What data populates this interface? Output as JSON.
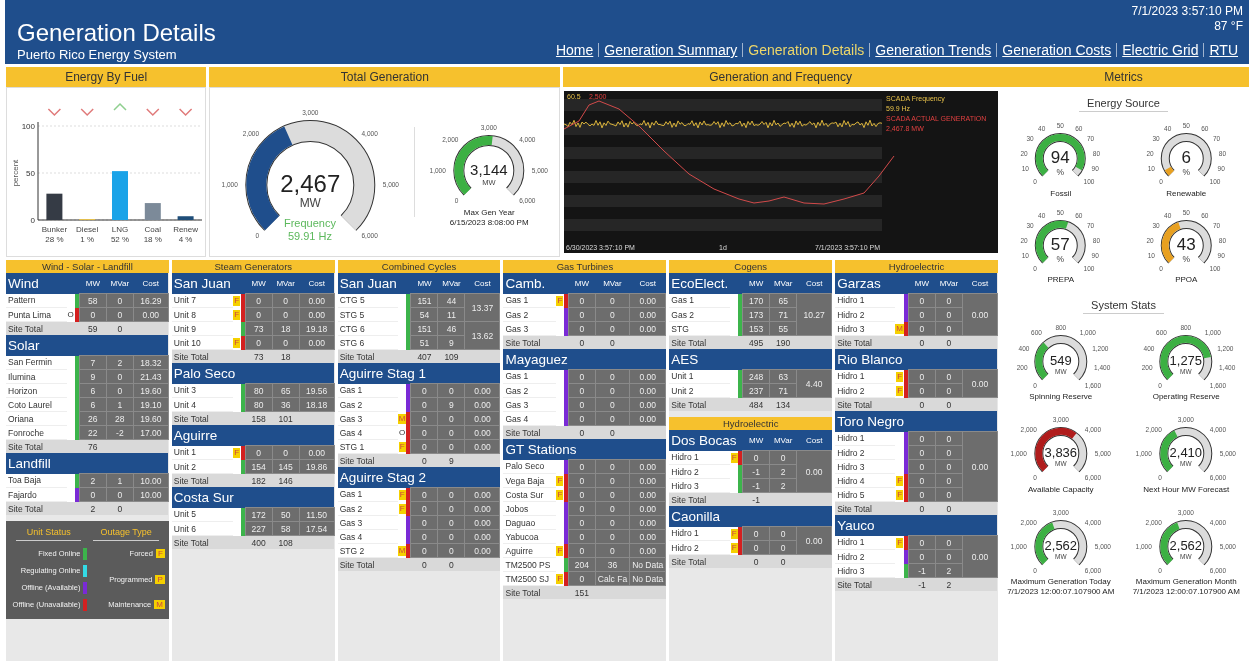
{
  "header": {
    "title": "Generation Details",
    "subtitle": "Puerto Rico Energy System",
    "datetime": "7/1/2023 3:57:10 PM",
    "temperature": "87 °F",
    "nav": [
      {
        "label": "Home",
        "selected": false
      },
      {
        "label": "Generation Summary",
        "selected": false
      },
      {
        "label": "Generation Details",
        "selected": true
      },
      {
        "label": "Generation Trends",
        "selected": false
      },
      {
        "label": "Generation Costs",
        "selected": false
      },
      {
        "label": "Electric Grid",
        "selected": false
      },
      {
        "label": "RTU",
        "selected": false
      }
    ]
  },
  "energy_by_fuel": {
    "title": "Energy By Fuel",
    "bars": [
      {
        "rising": false,
        "color": "#353b45",
        "value_label": "28 %"
      },
      {
        "rising": false,
        "color": "#e8c24a",
        "value_label": "1 %"
      },
      {
        "rising": true,
        "color": "#1aa3e8",
        "value_label": "52 %"
      },
      {
        "rising": false,
        "color": "#7c8a99",
        "value_label": "18 %"
      },
      {
        "rising": false,
        "color": "#1f4e79",
        "value_label": "4 %"
      }
    ],
    "chart_data": {
      "type": "bar",
      "ylabel": "percent",
      "categories": [
        "Bunker",
        "Diesel",
        "LNG",
        "Coal",
        "Renew"
      ],
      "values": [
        28,
        1,
        52,
        18,
        4
      ],
      "ylim": [
        0,
        100
      ],
      "yticks": [
        0,
        50,
        100
      ]
    }
  },
  "total_generation": {
    "title": "Total Generation",
    "main_gauge": {
      "value": "2,467",
      "unit": "MW",
      "color": "#1f4e8c",
      "ticks": [
        "0",
        "1,000",
        "2,000",
        "3,000",
        "4,000",
        "5,000",
        "6,000"
      ],
      "caption": "Frequency",
      "reading": "59.91 Hz"
    },
    "max_gauge": {
      "value": "3,144",
      "unit": "MW",
      "color": "#3cb043",
      "ticks": [
        "0",
        "1,000",
        "2,000",
        "3,000",
        "4,000",
        "5,000",
        "6,000"
      ],
      "caption": "Max Gen Year",
      "reading": "6/15/2023 8:08:00 PM"
    }
  },
  "generation_frequency": {
    "title": "Generation and Frequency",
    "axis_top": [
      {
        "text": "60.5",
        "kind": "frequency"
      },
      {
        "text": "2,500",
        "kind": "generation"
      }
    ],
    "legend": [
      {
        "text": "SCADA Frequency",
        "kind": "frequency"
      },
      {
        "text": "59.9 Hz",
        "kind": "frequency"
      },
      {
        "text": "SCADA ACTUAL GENERATION",
        "kind": "generation"
      },
      {
        "text": "2,467.8 MW",
        "kind": "generation"
      }
    ],
    "x_labels": [
      "6/30/2023 3:57:10 PM",
      "1d",
      "7/1/2023 3:57:10 PM"
    ]
  },
  "metrics": {
    "title": "Metrics",
    "sections": [
      {
        "title": "Energy Source",
        "gauges": [
          {
            "value": "94",
            "unit": "%",
            "label": "Fossil",
            "color": "#3cb043",
            "ticks": [
              "0",
              "10",
              "20",
              "30",
              "40",
              "50",
              "60",
              "70",
              "80",
              "90",
              "100"
            ]
          },
          {
            "value": "6",
            "unit": "%",
            "label": "Renewable",
            "color": "#e8a020",
            "ticks": [
              "0",
              "10",
              "20",
              "30",
              "40",
              "50",
              "60",
              "70",
              "80",
              "90",
              "100"
            ]
          },
          {
            "value": "57",
            "unit": "%",
            "label": "PREPA",
            "color": "#3cb043",
            "ticks": [
              "0",
              "10",
              "20",
              "30",
              "40",
              "50",
              "60",
              "70",
              "80",
              "90",
              "100"
            ]
          },
          {
            "value": "43",
            "unit": "%",
            "label": "PPOA",
            "color": "#e8a020",
            "ticks": [
              "0",
              "10",
              "20",
              "30",
              "40",
              "50",
              "60",
              "70",
              "80",
              "90",
              "100"
            ]
          }
        ]
      },
      {
        "title": "System Stats",
        "gauges": [
          {
            "value": "549",
            "unit": "MW",
            "label": "Spinning Reserve",
            "color": "#3cb043",
            "ticks": [
              "0",
              "200",
              "400",
              "600",
              "800",
              "1,000",
              "1,200",
              "1,400",
              "1,600"
            ]
          },
          {
            "value": "1,275",
            "unit": "MW",
            "label": "Operating Reserve",
            "color": "#3cb043",
            "ticks": [
              "0",
              "200",
              "400",
              "600",
              "800",
              "1,000",
              "1,200",
              "1,400",
              "1,600"
            ]
          },
          {
            "value": "3,836",
            "unit": "MW",
            "label": "Available Capacity",
            "color": "#b01c1c",
            "ticks": [
              "0",
              "1,000",
              "2,000",
              "3,000",
              "4,000",
              "5,000",
              "6,000"
            ]
          },
          {
            "value": "2,410",
            "unit": "MW",
            "label": "Next Hour MW Forecast",
            "color": "#3cb043",
            "ticks": [
              "0",
              "1,000",
              "2,000",
              "3,000",
              "4,000",
              "5,000",
              "6,000"
            ]
          },
          {
            "value": "2,562",
            "unit": "MW",
            "label": "Maximum Generation Today",
            "sublabel": "7/1/2023 12:00:07.107900 AM",
            "color": "#3cb043",
            "ticks": [
              "0",
              "1,000",
              "2,000",
              "3,000",
              "4,000",
              "5,000",
              "6,000"
            ]
          },
          {
            "value": "2,562",
            "unit": "MW",
            "label": "Maximum Generation Month",
            "sublabel": "7/1/2023 12:00:07.107900 AM",
            "color": "#3cb043",
            "ticks": [
              "0",
              "1,000",
              "2,000",
              "3,000",
              "4,000",
              "5,000",
              "6,000"
            ]
          }
        ]
      }
    ]
  },
  "unit_columns": [
    [
      {
        "kind": "units",
        "title": "Wind - Solar - Landfill",
        "sites": [
          {
            "name": "Wind",
            "columns": [
              "MW",
              "MVar",
              "Cost"
            ],
            "units": [
              {
                "name": "Pattern",
                "color": "#3cb44b",
                "mw": "58",
                "mvar": "0",
                "cost": "16.29"
              },
              {
                "name": "Punta Lima",
                "color": "#d42020",
                "flag": "O",
                "flag_boxed": false,
                "mw": "0",
                "mvar": "0",
                "cost": "0.00"
              }
            ],
            "total": {
              "label": "Site Total",
              "mw": "59",
              "mvar": "0"
            }
          },
          {
            "name": "Solar",
            "units": [
              {
                "name": "San Fermin",
                "color": "#3cb44b",
                "mw": "7",
                "mvar": "2",
                "cost": "18.32"
              },
              {
                "name": "Ilumina",
                "color": "#3cb44b",
                "mw": "9",
                "mvar": "0",
                "cost": "21.43"
              },
              {
                "name": "Horizon",
                "color": "#3cb44b",
                "mw": "6",
                "mvar": "0",
                "cost": "19.60"
              },
              {
                "name": "Coto Laurel",
                "color": "#3cb44b",
                "mw": "6",
                "mvar": "1",
                "cost": "19.10"
              },
              {
                "name": "Oriana",
                "color": "#3cb44b",
                "mw": "26",
                "mvar": "28",
                "cost": "19.60"
              },
              {
                "name": "Fonroche",
                "color": "#3cb44b",
                "mw": "22",
                "mvar": "-2",
                "cost": "17.00"
              }
            ],
            "total": {
              "label": "Site Total",
              "mw": "76"
            }
          },
          {
            "name": "Landfill",
            "units": [
              {
                "name": "Toa Baja",
                "color": "#3cb44b",
                "mw": "2",
                "mvar": "1",
                "cost": "10.00"
              },
              {
                "name": "Fajardo",
                "color": "#7a2ad6",
                "mw": "0",
                "mvar": "0",
                "cost": "10.00"
              }
            ],
            "total": {
              "label": "Site Total",
              "mw": "2",
              "mvar": "0"
            }
          }
        ]
      },
      {
        "kind": "legend",
        "status_title": "Unit Status",
        "outage_title": "Outage Type",
        "statuses": [
          {
            "label": "Fixed Online",
            "color": "#3cb44b"
          },
          {
            "label": "Regulating Online",
            "color": "#33dbe6"
          },
          {
            "label": "Offline (Available)",
            "color": "#7a2ad6"
          },
          {
            "label": "Offline (Unavailable)",
            "color": "#d42020"
          }
        ],
        "outages": [
          {
            "label": "Forced",
            "flag": "F"
          },
          {
            "label": "Programmed",
            "flag": "P"
          },
          {
            "label": "Maintenance",
            "flag": "M"
          }
        ]
      }
    ],
    [
      {
        "kind": "units",
        "title": "Steam Generators",
        "sites": [
          {
            "name": "San Juan",
            "columns": [
              "MW",
              "MVar",
              "Cost"
            ],
            "units": [
              {
                "name": "Unit 7",
                "color": "#d42020",
                "flag": "F",
                "flag_boxed": true,
                "mw": "0",
                "mvar": "0",
                "cost": "0.00"
              },
              {
                "name": "Unit 8",
                "color": "#d42020",
                "flag": "F",
                "flag_boxed": true,
                "mw": "0",
                "mvar": "0",
                "cost": "0.00"
              },
              {
                "name": "Unit 9",
                "color": "#3cb44b",
                "mw": "73",
                "mvar": "18",
                "cost": "19.18"
              },
              {
                "name": "Unit 10",
                "color": "#d42020",
                "flag": "F",
                "flag_boxed": true,
                "mw": "0",
                "mvar": "0",
                "cost": "0.00"
              }
            ],
            "total": {
              "label": "Site Total",
              "mw": "73",
              "mvar": "18"
            }
          },
          {
            "name": "Palo Seco",
            "units": [
              {
                "name": "Unit 3",
                "color": "#3cb44b",
                "mw": "80",
                "mvar": "65",
                "cost": "19.56"
              },
              {
                "name": "Unit 4",
                "color": "#3cb44b",
                "mw": "80",
                "mvar": "36",
                "cost": "18.18"
              }
            ],
            "total": {
              "label": "Site Total",
              "mw": "158",
              "mvar": "101"
            }
          },
          {
            "name": "Aguirre",
            "units": [
              {
                "name": "Unit 1",
                "color": "#d42020",
                "flag": "F",
                "flag_boxed": true,
                "mw": "0",
                "mvar": "0",
                "cost": "0.00"
              },
              {
                "name": "Unit 2",
                "color": "#3cb44b",
                "mw": "154",
                "mvar": "145",
                "cost": "19.86"
              }
            ],
            "total": {
              "label": "Site Total",
              "mw": "182",
              "mvar": "146"
            }
          },
          {
            "name": "Costa Sur",
            "units": [
              {
                "name": "Unit 5",
                "color": "#3cb44b",
                "mw": "172",
                "mvar": "50",
                "cost": "11.50"
              },
              {
                "name": "Unit 6",
                "color": "#3cb44b",
                "mw": "227",
                "mvar": "58",
                "cost": "17.54"
              }
            ],
            "total": {
              "label": "Site Total",
              "mw": "400",
              "mvar": "108"
            }
          }
        ]
      }
    ],
    [
      {
        "kind": "units",
        "title": "Combined Cycles",
        "sites": [
          {
            "name": "San Juan",
            "columns": [
              "MW",
              "MVar",
              "Cost"
            ],
            "units": [
              {
                "name": "CTG 5",
                "color": "#3cb44b",
                "mw": "151",
                "mvar": "44",
                "cost": "13.37"
              },
              {
                "name": "STG 5",
                "color": "#3cb44b",
                "mw": "54",
                "mvar": "11"
              },
              {
                "name": "CTG 6",
                "color": "#3cb44b",
                "mw": "151",
                "mvar": "46",
                "cost": "13.62"
              },
              {
                "name": "STG 6",
                "color": "#3cb44b",
                "mw": "51",
                "mvar": "9"
              }
            ],
            "total": {
              "label": "Site Total",
              "mw": "407",
              "mvar": "109"
            }
          },
          {
            "name": "Aguirre Stag 1",
            "units": [
              {
                "name": "Gas 1",
                "color": "#7a2ad6",
                "mw": "0",
                "mvar": "0",
                "cost": "0.00"
              },
              {
                "name": "Gas 2",
                "color": "#7a2ad6",
                "mw": "0",
                "mvar": "9",
                "cost": "0.00"
              },
              {
                "name": "Gas 3",
                "color": "#d42020",
                "flag": "M",
                "flag_boxed": true,
                "mw": "0",
                "mvar": "0",
                "cost": "0.00"
              },
              {
                "name": "Gas 4",
                "color": "#d42020",
                "flag": "O",
                "flag_boxed": false,
                "mw": "0",
                "mvar": "0",
                "cost": "0.00"
              },
              {
                "name": "STG 1",
                "color": "#d42020",
                "flag": "F",
                "flag_boxed": true,
                "mw": "0",
                "mvar": "0",
                "cost": "0.00"
              }
            ],
            "total": {
              "label": "Site Total",
              "mw": "0",
              "mvar": "9"
            }
          },
          {
            "name": "Aguirre Stag 2",
            "units": [
              {
                "name": "Gas 1",
                "color": "#d42020",
                "flag": "F",
                "flag_boxed": true,
                "mw": "0",
                "mvar": "0",
                "cost": "0.00"
              },
              {
                "name": "Gas 2",
                "color": "#d42020",
                "flag": "F",
                "flag_boxed": true,
                "mw": "0",
                "mvar": "0",
                "cost": "0.00"
              },
              {
                "name": "Gas 3",
                "color": "#7a2ad6",
                "mw": "0",
                "mvar": "0",
                "cost": "0.00"
              },
              {
                "name": "Gas 4",
                "color": "#7a2ad6",
                "mw": "0",
                "mvar": "0",
                "cost": "0.00"
              },
              {
                "name": "STG 2",
                "color": "#d42020",
                "flag": "M",
                "flag_boxed": true,
                "mw": "0",
                "mvar": "0",
                "cost": "0.00"
              }
            ],
            "total": {
              "label": "Site Total",
              "mw": "0",
              "mvar": "0"
            }
          }
        ]
      }
    ],
    [
      {
        "kind": "units",
        "title": "Gas Turbines",
        "sites": [
          {
            "name": "Camb.",
            "columns": [
              "MW",
              "MVar",
              "Cost"
            ],
            "units": [
              {
                "name": "Gas 1",
                "color": "#d42020",
                "flag": "F",
                "flag_boxed": true,
                "mw": "0",
                "mvar": "0",
                "cost": "0.00"
              },
              {
                "name": "Gas 2",
                "color": "#7a2ad6",
                "mw": "0",
                "mvar": "0",
                "cost": "0.00"
              },
              {
                "name": "Gas 3",
                "color": "#7a2ad6",
                "mw": "0",
                "mvar": "0",
                "cost": "0.00"
              }
            ],
            "total": {
              "label": "Site Total",
              "mw": "0",
              "mvar": "0"
            }
          },
          {
            "name": "Mayaguez",
            "units": [
              {
                "name": "Gas 1",
                "color": "#7a2ad6",
                "mw": "0",
                "mvar": "0",
                "cost": "0.00"
              },
              {
                "name": "Gas 2",
                "color": "#7a2ad6",
                "mw": "0",
                "mvar": "0",
                "cost": "0.00"
              },
              {
                "name": "Gas 3",
                "color": "#7a2ad6",
                "mw": "0",
                "mvar": "0",
                "cost": "0.00"
              },
              {
                "name": "Gas 4",
                "color": "#7a2ad6",
                "mw": "0",
                "mvar": "0",
                "cost": "0.00"
              }
            ],
            "total": {
              "label": "Site Total",
              "mw": "0",
              "mvar": "0"
            }
          },
          {
            "name": "GT Stations",
            "units": [
              {
                "name": "Palo Seco",
                "color": "#7a2ad6",
                "mw": "0",
                "mvar": "0",
                "cost": "0.00"
              },
              {
                "name": "Vega Baja",
                "color": "#d42020",
                "flag": "F",
                "flag_boxed": true,
                "mw": "0",
                "mvar": "0",
                "cost": "0.00"
              },
              {
                "name": "Costa Sur",
                "color": "#d42020",
                "flag": "F",
                "flag_boxed": true,
                "mw": "0",
                "mvar": "0",
                "cost": "0.00"
              },
              {
                "name": "Jobos",
                "color": "#7a2ad6",
                "mw": "0",
                "mvar": "0",
                "cost": "0.00"
              },
              {
                "name": "Daguao",
                "color": "#7a2ad6",
                "mw": "0",
                "mvar": "0",
                "cost": "0.00"
              },
              {
                "name": "Yabucoa",
                "color": "#7a2ad6",
                "mw": "0",
                "mvar": "0",
                "cost": "0.00"
              },
              {
                "name": "Aguirre",
                "color": "#d42020",
                "flag": "F",
                "flag_boxed": true,
                "mw": "0",
                "mvar": "0",
                "cost": "0.00"
              },
              {
                "name": "TM2500 PS",
                "color": "#3cb44b",
                "mw": "204",
                "mvar": "36",
                "cost": "No Data"
              },
              {
                "name": "TM2500 SJ",
                "color": "#d42020",
                "flag": "F",
                "flag_boxed": true,
                "mw": "0",
                "mvar": "Calc Fa",
                "cost": "No Data"
              }
            ],
            "total": {
              "label": "Site Total",
              "mw": "151"
            }
          }
        ]
      }
    ],
    [
      {
        "kind": "units",
        "title": "Cogens",
        "sites": [
          {
            "name": "EcoElect.",
            "columns": [
              "MW",
              "MVar",
              "Cost"
            ],
            "units": [
              {
                "name": "Gas 1",
                "color": "#3cb44b",
                "mw": "170",
                "mvar": "65",
                "cost": "10.27"
              },
              {
                "name": "Gas 2",
                "color": "#3cb44b",
                "mw": "173",
                "mvar": "71"
              },
              {
                "name": "STG",
                "color": "#3cb44b",
                "mw": "153",
                "mvar": "55"
              }
            ],
            "total": {
              "label": "Site Total",
              "mw": "495",
              "mvar": "190"
            }
          },
          {
            "name": "AES",
            "units": [
              {
                "name": "Unit 1",
                "color": "#3cb44b",
                "mw": "248",
                "mvar": "63",
                "cost": "4.40"
              },
              {
                "name": "Unit 2",
                "color": "#3cb44b",
                "mw": "237",
                "mvar": "71"
              }
            ],
            "total": {
              "label": "Site Total",
              "mw": "484",
              "mvar": "134"
            }
          }
        ]
      },
      {
        "kind": "units",
        "title": "Hydroelectric",
        "sites": [
          {
            "name": "Dos Bocas",
            "columns": [
              "MW",
              "MVar",
              "Cost"
            ],
            "units": [
              {
                "name": "Hidro 1",
                "color": "#d42020",
                "flag": "F",
                "flag_boxed": true,
                "mw": "0",
                "mvar": "0",
                "cost": "0.00"
              },
              {
                "name": "Hidro 2",
                "color": "#3cb44b",
                "mw": "-1",
                "mvar": "2"
              },
              {
                "name": "Hidro 3",
                "color": "#3cb44b",
                "mw": "-1",
                "mvar": "2"
              }
            ],
            "total": {
              "label": "Site Total",
              "mw": "-1"
            }
          },
          {
            "name": "Caonilla",
            "units": [
              {
                "name": "Hidro 1",
                "color": "#d42020",
                "flag": "F",
                "flag_boxed": true,
                "mw": "0",
                "mvar": "0",
                "cost": "0.00"
              },
              {
                "name": "Hidro 2",
                "color": "#d42020",
                "flag": "F",
                "flag_boxed": true,
                "mw": "0",
                "mvar": "0"
              }
            ],
            "total": {
              "label": "Site Total",
              "mw": "0",
              "mvar": "0"
            }
          }
        ]
      }
    ],
    [
      {
        "kind": "units",
        "title": "Hydroelectric",
        "sites": [
          {
            "name": "Garzas",
            "columns": [
              "MW",
              "MVar",
              "Cost"
            ],
            "units": [
              {
                "name": "Hidro 1",
                "color": "#7a2ad6",
                "mw": "0",
                "mvar": "0",
                "cost": "0.00"
              },
              {
                "name": "Hidro 2",
                "color": "#7a2ad6",
                "mw": "0",
                "mvar": "0"
              },
              {
                "name": "Hidro 3",
                "color": "#d42020",
                "flag": "M",
                "flag_boxed": true,
                "mw": "0",
                "mvar": "0"
              }
            ],
            "total": {
              "label": "Site Total",
              "mw": "0",
              "mvar": "0"
            }
          },
          {
            "name": "Rio Blanco",
            "units": [
              {
                "name": "Hidro 1",
                "color": "#d42020",
                "flag": "F",
                "flag_boxed": true,
                "mw": "0",
                "mvar": "0",
                "cost": "0.00"
              },
              {
                "name": "Hidro 2",
                "color": "#d42020",
                "flag": "F",
                "flag_boxed": true,
                "mw": "0",
                "mvar": "0"
              }
            ],
            "total": {
              "label": "Site Total",
              "mw": "0",
              "mvar": "0"
            }
          },
          {
            "name": "Toro Negro",
            "units": [
              {
                "name": "Hidro 1",
                "color": "#7a2ad6",
                "mw": "0",
                "mvar": "0",
                "cost": "0.00"
              },
              {
                "name": "Hidro 2",
                "color": "#7a2ad6",
                "mw": "0",
                "mvar": "0"
              },
              {
                "name": "Hidro 3",
                "color": "#7a2ad6",
                "mw": "0",
                "mvar": "0"
              },
              {
                "name": "Hidro 4",
                "color": "#d42020",
                "flag": "F",
                "flag_boxed": true,
                "mw": "0",
                "mvar": "0"
              },
              {
                "name": "Hidro 5",
                "color": "#d42020",
                "flag": "F",
                "flag_boxed": true,
                "mw": "0",
                "mvar": "0"
              }
            ],
            "total": {
              "label": "Site Total",
              "mw": "0",
              "mvar": "0"
            }
          },
          {
            "name": "Yauco",
            "units": [
              {
                "name": "Hidro 1",
                "color": "#d42020",
                "flag": "F",
                "flag_boxed": true,
                "mw": "0",
                "mvar": "0",
                "cost": "0.00"
              },
              {
                "name": "Hidro 2",
                "color": "#7a2ad6",
                "mw": "0",
                "mvar": "0"
              },
              {
                "name": "Hidro 3",
                "color": "#3cb44b",
                "mw": "-1",
                "mvar": "2"
              }
            ],
            "total": {
              "label": "Site Total",
              "mw": "-1",
              "mvar": "2"
            }
          }
        ]
      }
    ]
  ]
}
